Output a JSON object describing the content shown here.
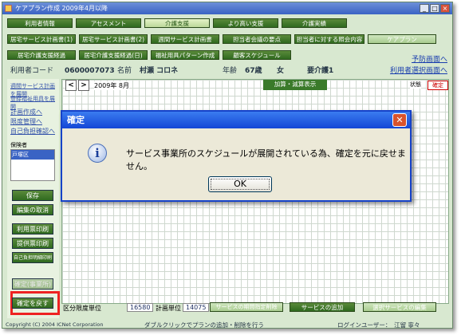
{
  "window": {
    "title": "ケアプラン作成 2009年4月以降"
  },
  "menu_row1": [
    "利用者情報",
    "アセスメント",
    "介護支援",
    "より高い支援",
    "介護実績"
  ],
  "menu_row2": [
    "居宅サービス計画書(1)",
    "居宅サービス計画書(2)",
    "週間サービス計画書",
    "担当者会議の要点",
    "担当者に対する照会内容",
    "ケアプラン"
  ],
  "menu_row3": [
    "居宅介護支援経過",
    "居宅介護支援経過(日)",
    "福祉用具パターン作成",
    "顧客スケジュール"
  ],
  "links": {
    "next_screen": "予防画面へ",
    "select_screen": "利用者選択画面へ"
  },
  "user": {
    "code_label": "利用者コード",
    "code": "0600007073",
    "name_label": "名前",
    "name": "村瀬 コロネ",
    "age_label": "年齢",
    "age": "67歳",
    "sex": "女",
    "care_level": "要介護1"
  },
  "period": {
    "month": "2009年 8月",
    "prev": "<",
    "next": ">",
    "status_label": "状態",
    "confirm": "確定",
    "addsub": "加算・減算表示"
  },
  "left": {
    "links": [
      "週間サービス計画を展開",
      "登録福祉用具を展開",
      "計画作成へ",
      "限度管理へ",
      "自己負担確認へ"
    ],
    "insurer_label": "保険者",
    "insurer_value": "戸塚区",
    "buttons": [
      "保存",
      "編集の取消",
      "利用票印刷",
      "提供票印刷",
      "自己負担明細印刷",
      "確定(事業所)",
      "確定を戻す"
    ]
  },
  "bottom": {
    "limit_label": "区分限度単位",
    "limit_value": "16580",
    "plan_label": "計画単位",
    "plan_value": "14075",
    "remove": "サービスの期間指定削除",
    "add": "サービスの追加",
    "edit": "選択サービスの編集",
    "hint": "ダブルクリックでプランの追加・削除を行う",
    "login": "ログインユーザー：　江留 寧々"
  },
  "copyright": "Copyright (C) 2004 ICNet Corporation",
  "dialog": {
    "title": "確定",
    "message": "サービス事業所のスケジュールが展開されている為、確定を元に戻せません。",
    "ok": "OK",
    "close": "✕",
    "icon": "i"
  }
}
